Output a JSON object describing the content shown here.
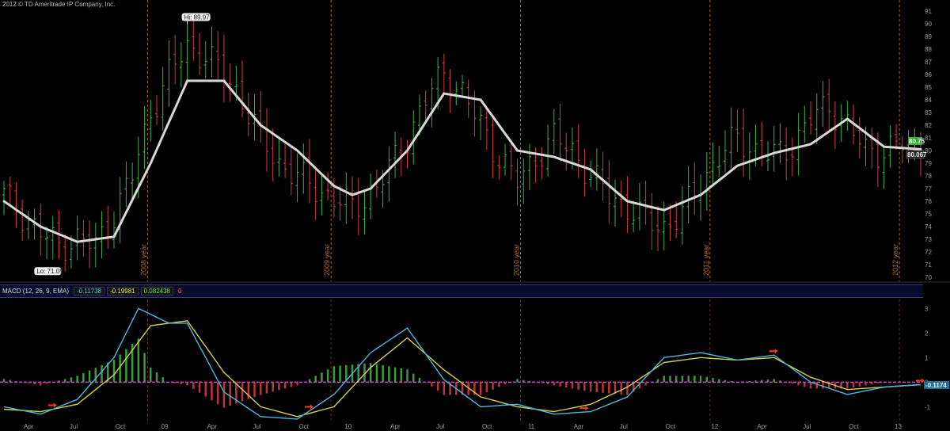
{
  "copyright": "2012 © TD Ameritrade IP Company, Inc.",
  "annotations": {
    "hi": "Hi: 89.97",
    "lo": "Lo: 71.05"
  },
  "price_tags": {
    "last": "80.75",
    "ma": "80.067"
  },
  "macd": {
    "title": "MACD (12, 26, 9, EMA)",
    "value": "-0.11738",
    "avg": "-0.19981",
    "diff": "0.082438",
    "zero": "0",
    "tag": "-0.1174"
  },
  "colors": {
    "up": "#3fae3f",
    "down": "#d23b3b",
    "ma": "#d8d8d8",
    "macd_line": "#4ab8e0",
    "signal_line": "#d6cf4a",
    "zero_line": "#e040e0",
    "year_line": "#b06a1e",
    "arrow": "#ff3b1f"
  },
  "chart_data": [
    {
      "type": "candlestick",
      "price_axis": {
        "ylim": [
          70,
          91
        ],
        "ticks": [
          70,
          71,
          72,
          73,
          74,
          75,
          76,
          77,
          78,
          79,
          80,
          81,
          82,
          83,
          84,
          85,
          86,
          87,
          88,
          89,
          90,
          91
        ]
      },
      "year_markers": [
        "2008 year",
        "2009 year",
        "2010 year",
        "2011 year",
        "2012 year"
      ],
      "x_tick_labels": [
        "Apr",
        "Jul",
        "Oct",
        "09",
        "Apr",
        "Jul",
        "Oct",
        "10",
        "Apr",
        "Jul",
        "Oct",
        "11",
        "Apr",
        "Jul",
        "Oct",
        "12",
        "Apr",
        "Jul",
        "Oct",
        "13"
      ],
      "price_path": [
        [
          0,
          76.5
        ],
        [
          3,
          75
        ],
        [
          6,
          73.5
        ],
        [
          9,
          72.5
        ],
        [
          12,
          73
        ],
        [
          15,
          72.5
        ],
        [
          18,
          75
        ],
        [
          21,
          78
        ],
        [
          24,
          83
        ],
        [
          27,
          86
        ],
        [
          30,
          88.2
        ],
        [
          33,
          87.5
        ],
        [
          36,
          86
        ],
        [
          39,
          84
        ],
        [
          42,
          81
        ],
        [
          45,
          79
        ],
        [
          48,
          78
        ],
        [
          51,
          77
        ],
        [
          54,
          76.2
        ],
        [
          57,
          75.5
        ],
        [
          60,
          76.5
        ],
        [
          63,
          78.5
        ],
        [
          66,
          81
        ],
        [
          69,
          84
        ],
        [
          72,
          86.2
        ],
        [
          75,
          84.5
        ],
        [
          78,
          82
        ],
        [
          81,
          79.5
        ],
        [
          84,
          77.5
        ],
        [
          87,
          79.5
        ],
        [
          90,
          81
        ],
        [
          93,
          80
        ],
        [
          96,
          78
        ],
        [
          99,
          76.5
        ],
        [
          102,
          75.5
        ],
        [
          105,
          74.5
        ],
        [
          108,
          74
        ],
        [
          111,
          75
        ],
        [
          114,
          77.5
        ],
        [
          117,
          79.5
        ],
        [
          120,
          81
        ],
        [
          123,
          80
        ],
        [
          126,
          79.5
        ],
        [
          129,
          80.5
        ],
        [
          132,
          82.5
        ],
        [
          135,
          83.5
        ],
        [
          138,
          82
        ],
        [
          141,
          80
        ],
        [
          144,
          80
        ],
        [
          147,
          80.5
        ],
        [
          150,
          80.5
        ]
      ],
      "moving_average": [
        [
          0,
          76
        ],
        [
          6,
          74
        ],
        [
          12,
          72.8
        ],
        [
          18,
          73.2
        ],
        [
          24,
          79
        ],
        [
          30,
          85.5
        ],
        [
          36,
          85.5
        ],
        [
          42,
          82
        ],
        [
          48,
          80
        ],
        [
          54,
          77.2
        ],
        [
          57,
          76.5
        ],
        [
          60,
          77
        ],
        [
          66,
          80
        ],
        [
          72,
          84.5
        ],
        [
          78,
          84
        ],
        [
          84,
          80
        ],
        [
          90,
          79.5
        ],
        [
          96,
          78.5
        ],
        [
          102,
          76
        ],
        [
          108,
          75.3
        ],
        [
          114,
          76.5
        ],
        [
          120,
          78.8
        ],
        [
          126,
          79.8
        ],
        [
          132,
          80.5
        ],
        [
          138,
          82.5
        ],
        [
          144,
          80.3
        ],
        [
          150,
          80.1
        ]
      ],
      "hi": {
        "index": 30,
        "value": 89.97
      },
      "lo": {
        "index": 6,
        "value": 71.05
      },
      "last": 80.75,
      "ma_last": 80.067
    },
    {
      "type": "line+histogram",
      "title": "MACD (12, 26, 9, EMA)",
      "ylim": [
        -1.6,
        3.3
      ],
      "ticks": [
        -1,
        0,
        1,
        2,
        3
      ],
      "macd_path": [
        [
          0,
          -1
        ],
        [
          6,
          -1.3
        ],
        [
          12,
          -0.7
        ],
        [
          18,
          1.0
        ],
        [
          22,
          3.0
        ],
        [
          27,
          2.4
        ],
        [
          30,
          2.4
        ],
        [
          36,
          -0.4
        ],
        [
          42,
          -1.4
        ],
        [
          48,
          -1.5
        ],
        [
          54,
          -0.5
        ],
        [
          60,
          1.2
        ],
        [
          66,
          2.2
        ],
        [
          72,
          0.1
        ],
        [
          78,
          -1.0
        ],
        [
          84,
          -0.9
        ],
        [
          90,
          -1.3
        ],
        [
          96,
          -1.2
        ],
        [
          102,
          -0.6
        ],
        [
          108,
          1.0
        ],
        [
          114,
          1.2
        ],
        [
          120,
          0.9
        ],
        [
          126,
          1.1
        ],
        [
          132,
          0.0
        ],
        [
          138,
          -0.5
        ],
        [
          144,
          -0.2
        ],
        [
          150,
          -0.1
        ]
      ],
      "signal_path": [
        [
          0,
          -1.1
        ],
        [
          6,
          -1.2
        ],
        [
          12,
          -0.9
        ],
        [
          18,
          0.3
        ],
        [
          24,
          2.3
        ],
        [
          30,
          2.5
        ],
        [
          36,
          0.4
        ],
        [
          42,
          -1.0
        ],
        [
          48,
          -1.4
        ],
        [
          54,
          -1.0
        ],
        [
          60,
          0.6
        ],
        [
          66,
          1.8
        ],
        [
          72,
          0.5
        ],
        [
          78,
          -0.6
        ],
        [
          84,
          -1.0
        ],
        [
          90,
          -1.2
        ],
        [
          96,
          -0.9
        ],
        [
          102,
          -0.2
        ],
        [
          108,
          0.8
        ],
        [
          114,
          1.0
        ],
        [
          120,
          0.9
        ],
        [
          126,
          1.0
        ],
        [
          132,
          0.2
        ],
        [
          138,
          -0.3
        ],
        [
          144,
          -0.2
        ],
        [
          150,
          -0.1
        ]
      ],
      "arrow_indices": [
        8,
        50,
        95,
        126,
        151
      ],
      "last_value": -0.1174
    }
  ]
}
